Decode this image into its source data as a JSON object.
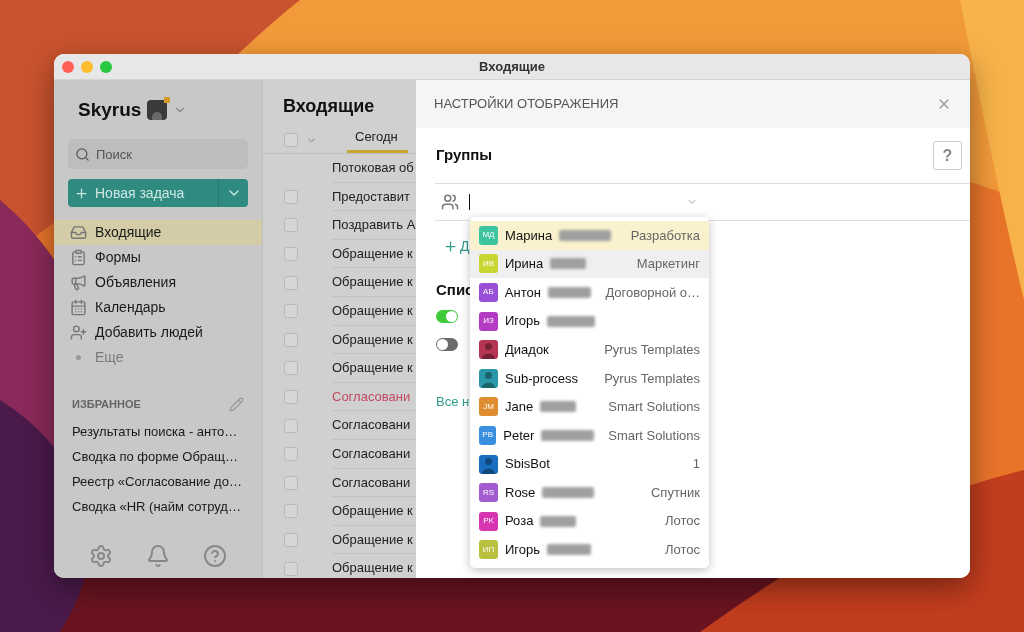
{
  "window": {
    "title": "Входящие"
  },
  "sidebar": {
    "brand": "Skyrus",
    "search": {
      "placeholder": "Поиск"
    },
    "new_task": "Новая задача",
    "nav": [
      {
        "label": "Входящие",
        "kind": "item",
        "selected": true
      },
      {
        "label": "Формы",
        "kind": "item",
        "selected": false
      },
      {
        "label": "Объявления",
        "kind": "item",
        "selected": false
      },
      {
        "label": "Календарь",
        "kind": "item",
        "selected": false
      },
      {
        "label": "Добавить людей",
        "kind": "item",
        "selected": false
      },
      {
        "label": "Еще",
        "kind": "more",
        "selected": false
      }
    ],
    "favorites_title": "ИЗБРАННОЕ",
    "favorites": [
      "Результаты поиска - анто…",
      "Сводка по форме Обращ…",
      "Реестр «Согласование до…",
      "Сводка «HR (найм сотруд…"
    ]
  },
  "inbox": {
    "title": "Входящие",
    "select_all_checked": false,
    "tabs": [
      {
        "label": "Сегодн",
        "selected": true
      }
    ],
    "rows": [
      {
        "text": "Потоковая об",
        "kind": "stream",
        "overdue": false
      },
      {
        "text": "Предоставит",
        "kind": "task",
        "checked": false,
        "overdue": false
      },
      {
        "text": "Поздравить А",
        "kind": "task",
        "checked": false,
        "overdue": false
      },
      {
        "text": "Обращение к",
        "kind": "task",
        "checked": false,
        "overdue": false
      },
      {
        "text": "Обращение к",
        "kind": "task",
        "checked": false,
        "overdue": false
      },
      {
        "text": "Обращение к",
        "kind": "task",
        "checked": false,
        "overdue": false
      },
      {
        "text": "Обращение к",
        "kind": "task",
        "checked": false,
        "overdue": false
      },
      {
        "text": "Обращение к",
        "kind": "task",
        "checked": false,
        "overdue": false
      },
      {
        "text": "Согласовани",
        "kind": "task",
        "checked": false,
        "overdue": true
      },
      {
        "text": "Согласовани",
        "kind": "task",
        "checked": false,
        "overdue": false
      },
      {
        "text": "Согласовани",
        "kind": "task",
        "checked": false,
        "overdue": false
      },
      {
        "text": "Согласовани",
        "kind": "task",
        "checked": false,
        "overdue": false
      },
      {
        "text": "Обращение к",
        "kind": "task",
        "checked": false,
        "overdue": false
      },
      {
        "text": "Обращение к",
        "kind": "task",
        "checked": false,
        "overdue": false
      },
      {
        "text": "Обращение к",
        "kind": "task",
        "checked": false,
        "overdue": false
      }
    ]
  },
  "panel": {
    "title": "НАСТРОЙКИ ОТОБРАЖЕНИЯ",
    "groups_label": "Группы",
    "help": "?",
    "add_link": "Д",
    "list_heading": "Спис",
    "toggles": [
      {
        "on": true
      },
      {
        "on": false
      }
    ],
    "all_link": "Все н",
    "dropdown": [
      {
        "kind": "person",
        "initials": "МД",
        "color": "#3cc4a0",
        "name": "Марина",
        "hidden_surname": true,
        "group": "Разработка",
        "selected": true,
        "hovered": false
      },
      {
        "kind": "person",
        "initials": "ИВ",
        "color": "#c9d531",
        "name": "Ирина",
        "hidden_surname": true,
        "group": "Маркетинг",
        "selected": false,
        "hovered": true
      },
      {
        "kind": "person",
        "initials": "АБ",
        "color": "#9a4fd8",
        "name": "Антон",
        "hidden_surname": true,
        "group": "Договорной о…",
        "selected": false,
        "hovered": false
      },
      {
        "kind": "person",
        "initials": "ИЗ",
        "color": "#b43cc2",
        "name": "Игорь",
        "hidden_surname": true,
        "selected": false,
        "hovered": false
      },
      {
        "kind": "bot",
        "color": "#b53452",
        "name": "Диадок",
        "hidden_surname": false,
        "group": "Pyrus Templates",
        "selected": false,
        "hovered": false
      },
      {
        "kind": "bot",
        "color": "#2a98a8",
        "name": "Sub-process",
        "hidden_surname": false,
        "group": "Pyrus Templates",
        "selected": false,
        "hovered": false
      },
      {
        "kind": "person",
        "initials": "JM",
        "color": "#e08c30",
        "name": "Jane",
        "hidden_surname": true,
        "group": "Smart Solutions",
        "selected": false,
        "hovered": false
      },
      {
        "kind": "person",
        "initials": "PB",
        "color": "#3a8fe0",
        "name": "Peter",
        "hidden_surname": true,
        "group": "Smart Solutions",
        "selected": false,
        "hovered": false
      },
      {
        "kind": "bot",
        "color": "#1a6ec0",
        "name": "SbisBot",
        "hidden_surname": false,
        "group": "1",
        "selected": false,
        "hovered": false
      },
      {
        "kind": "person",
        "initials": "RS",
        "color": "#a35bd0",
        "name": "Rose",
        "hidden_surname": true,
        "group": "Спутник",
        "selected": false,
        "hovered": false
      },
      {
        "kind": "person",
        "initials": "PK",
        "color": "#d836b0",
        "name": "Роза",
        "hidden_surname": true,
        "group": "Лотос",
        "selected": false,
        "hovered": false
      },
      {
        "kind": "person",
        "initials": "ИП",
        "color": "#b9c040",
        "name": "Игорь",
        "hidden_surname": true,
        "group": "Лотос",
        "selected": false,
        "hovered": false
      }
    ]
  }
}
